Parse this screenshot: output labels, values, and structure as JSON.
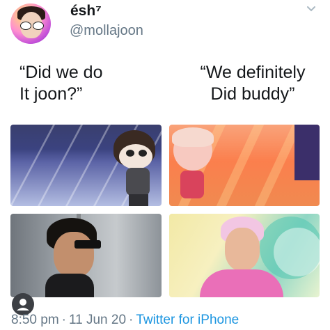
{
  "tweet": {
    "display_name": "ésh⁷",
    "handle": "@mollajoon",
    "menu_icon": "chevron-down-icon"
  },
  "meme": {
    "left_quote": "“Did we do\nIt joon?”",
    "right_quote": "“We definitely\nDid buddy”"
  },
  "images": [
    {
      "name": "cartoon-boy-on-purple-floor"
    },
    {
      "name": "cartoon-boy-on-orange-floor"
    },
    {
      "name": "man-with-sunglasses-grey-wall"
    },
    {
      "name": "man-in-pink-pastel-background"
    }
  ],
  "footer": {
    "time": "8:50 pm",
    "sep1": "·",
    "date": "11 Jun 20",
    "sep2": "·",
    "source": "Twitter for iPhone",
    "avatar_icon": "user-avatar-icon"
  },
  "colors": {
    "link": "#1b95e0",
    "secondary_text": "#657786"
  }
}
